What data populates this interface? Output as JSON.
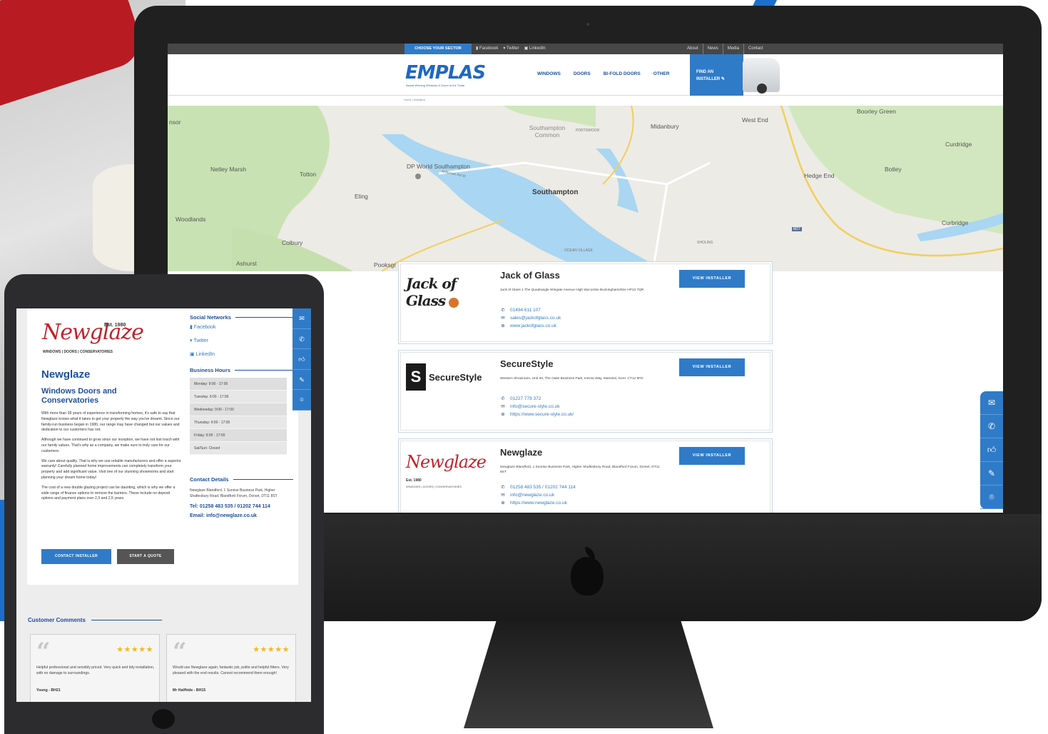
{
  "desktop": {
    "topbar": {
      "sector_button": "CHOOSE YOUR SECTOR",
      "social": [
        "Facebook",
        "Twitter",
        "LinkedIn"
      ],
      "links": [
        "About",
        "News",
        "Media",
        "Contact"
      ]
    },
    "header": {
      "logo": "EMPLAS",
      "logo_tagline": "Award Winning Windows & Doors to the Trade",
      "nav": [
        "WINDOWS",
        "DOORS",
        "BI-FOLD DOORS",
        "OTHER"
      ],
      "find_installer_line1": "FIND AN",
      "find_installer_line2": "INSTALLER"
    },
    "breadcrumb": "Home | Installers",
    "map": {
      "labels": [
        "nsor",
        "Southampton Common",
        "PORTSWOOD",
        "Midanbury",
        "West End",
        "Boorley Green",
        "Curdridge",
        "Netley Marsh",
        "Totton",
        "DP World Southampton",
        "Millbrook Rd W",
        "Southampton",
        "Hedge End",
        "Botley",
        "Eling",
        "Woodlands",
        "Colbury",
        "Ashurst",
        "Pooksgr",
        "OCEAN VILLAGE",
        "SHOLING",
        "Curbridge",
        "M27"
      ]
    },
    "installers": [
      {
        "name": "Jack of Glass",
        "logo_text": "Jack of Glass",
        "address": "Jack of Glass 1 The Quadrangle Wingate Avenue High Wycombe Buckinghamshire HP13 7QR",
        "phone": "01494 611 107",
        "email": "sales@jackofglass.co.uk",
        "website": "www.jackofglass.co.uk",
        "button": "VIEW INSTALLER"
      },
      {
        "name": "SecureStyle",
        "logo_text": "SecureStyle",
        "address": "Western Showroom, Unit 30, The Oaks Business Park, Invicta Way, Manston, Kent. CT12 5FD",
        "phone": "01227 779 372",
        "email": "info@secure-style.co.uk",
        "website": "https://www.secure-style.co.uk/",
        "button": "VIEW INSTALLER"
      },
      {
        "name": "Newglaze",
        "logo_text": "Newglaze",
        "logo_est": "Est. 1980",
        "logo_sub": "WINDOWS | DOORS | CONSERVATORIES",
        "address": "Newglaze Blandford, 1 Sunrise Business Park, Higher Shaftesbury Road, Blandford Forum, Dorset, DT11 8ST",
        "phone": "01258 483 535 / 01202 744 114",
        "email": "info@newglaze.co.uk",
        "website": "https://www.newglaze.co.uk",
        "button": "VIEW INSTALLER"
      }
    ],
    "side_icons": [
      "mail-icon",
      "phone-icon",
      "thumbs-up-icon",
      "tools-icon",
      "location-icon"
    ]
  },
  "tablet": {
    "logo": "Newglaze",
    "logo_est": "Est. 1980",
    "logo_sub": "WINDOWS | DOORS | CONSERVATORIES",
    "name": "Newglaze",
    "tagline": "Windows Doors and Conservatories",
    "paragraphs": [
      "With more than 39 years of experience in transforming homes, it's safe to say that Newglaze knows what it takes to get your property the way you've dreamt. Since our family-run business began in 1980, our range may have changed but our values and dedication to our customers has not.",
      "Although we have continued to grow since our inception, we have not lost touch with our family values. That's why as a company, we make sure to truly care for our customers.",
      "We care about quality. That is why we use reliable manufacturers and offer a superior warranty! Carefully planned home improvements can completely transform your property and add significant value. Visit one of our stunning showrooms and start planning your dream home today!",
      "The cost of a new double glazing project can be daunting, which is why we offer a wide range of finance options to remove the barriers. These include no deposit options and payment plans over 2,3 and 2,5 years."
    ],
    "contact_button": "CONTACT INSTALLER",
    "quote_button": "START A QUOTE",
    "social_heading": "Social Networks",
    "social": [
      "Facebook",
      "Twitter",
      "LinkedIn"
    ],
    "hours_heading": "Business Hours",
    "hours": [
      "Monday: 9:00 - 17:00",
      "Tuesday: 9:00 - 17:00",
      "Wednesday: 9:00 - 17:00",
      "Thursday: 9:00 - 17:00",
      "Friday: 9:00 - 17:00",
      "Sat/Sun: Closed"
    ],
    "contact_heading": "Contact Details",
    "contact_address": "Newglaze Blandford, 1 Sunrise Business Park, Higher Shaftesbury Road, Blandford Forum, Dorset, DT11 8ST",
    "contact_tel": "Tel: 01258 483 535 / 01202 744 114",
    "contact_email": "Email: info@newglaze.co.uk",
    "comments_heading": "Customer Comments",
    "comments": [
      {
        "text": "Helpful professional and sensibly priced. Very quick and tidy installation, with no damage to surroundings.",
        "author": "Young - BH21",
        "stars": "★★★★★"
      },
      {
        "text": "Would use Newglaze again; fantastic job, polite and helpful fitters. Very pleased with the end results. Cannot recommend them enough!",
        "author": "Mr Halfhide - BH15",
        "stars": "★★★★★"
      }
    ]
  },
  "colors": {
    "brand_blue": "#2f7bc8",
    "navy": "#1e4f9c",
    "newglaze_red": "#c0242b",
    "star": "#f3b818"
  }
}
